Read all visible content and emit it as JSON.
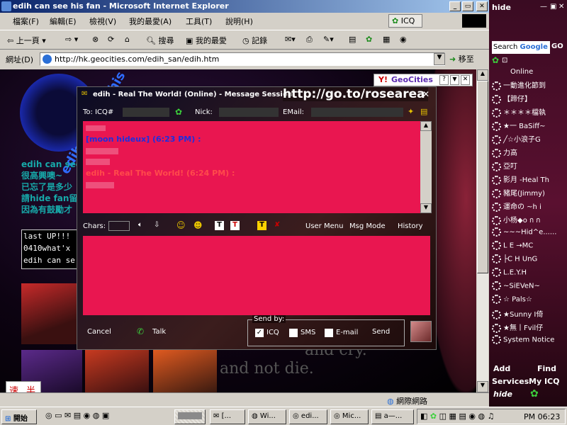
{
  "window": {
    "title": "edih can see his fan - Microsoft Internet Explorer"
  },
  "menu": [
    "檔案(F)",
    "編輯(E)",
    "檢視(V)",
    "我的最愛(A)",
    "工具(T)",
    "說明(H)"
  ],
  "toolbar": {
    "back": "上一頁",
    "search": "搜尋",
    "favorites": "我的最愛",
    "history": "記錄",
    "icq": "ICQ"
  },
  "address": {
    "label": "網址(D)",
    "url": "http://hk.geocities.com/edih_san/edih.htm",
    "go": "移至"
  },
  "page": {
    "arc_text": "edih can see his fan",
    "lines": [
      "edih can see his fan",
      "很高興噢~",
      "已忘了是多少",
      "請hide fan留",
      "因為有鼓勵才"
    ],
    "box_lines": [
      "last UP!!!",
      "0410what'x",
      "edih can se"
    ],
    "geocities": "GeoCities",
    "overlay_bottom": "and cry.",
    "overlay_bottom2": "and not die.",
    "quick_buttons": [
      "速",
      "半"
    ]
  },
  "status": {
    "zone": "網際網路"
  },
  "icq_panel": {
    "search_label": "Search",
    "google": "Google",
    "go": "GO",
    "online": "Online",
    "contacts": [
      "一動進化節到",
      "【蹄仔】",
      "＊＊＊＊檔執",
      "★一 BaSiff~",
      "╱☆小浪子G",
      "力高",
      "亞叮",
      "影月 -Heal Th",
      "豬尾(Jimmy)",
      "運命の ~h i",
      "小杨◆o ก ก",
      "~~~Hid^e......",
      "L E →MC",
      "├C H UnG",
      "L.E.Y.H",
      "~SiEVeN~",
      "☆ Pals☆",
      "★Sunny Ⅰ倚",
      "★無丨Fvil仔",
      "System Notice"
    ],
    "add": "Add",
    "find": "Find",
    "services": "Services",
    "my_icq": "My ICQ",
    "footer": "hide"
  },
  "msg": {
    "title": "edih - Real The World! (Online) - Message Session",
    "overlay_url": "http://go.to/rosearea",
    "to_label": "To: ICQ#",
    "nick_label": "Nick:",
    "email_label": "EMail:",
    "incoming_lines": [
      {
        "text": "[moon hideux]   (6:23 PM) :",
        "color": "#1d2fe0"
      },
      {
        "text": "edih - Real The World!  (6:24 PM) :",
        "color": "#ff2020"
      }
    ],
    "chars_label": "Chars:",
    "user_menu": "User Menu",
    "msg_mode": "Msg Mode",
    "history": "History",
    "send_by": "Send by:",
    "opt_icq": "ICQ",
    "opt_sms": "SMS",
    "opt_email": "E-mail",
    "cancel": "Cancel",
    "talk": "Talk",
    "send": "Send"
  },
  "taskbar": {
    "start": "開始",
    "tasks": [
      "[...",
      "Wi...",
      "edi...",
      "Mic...",
      "a—..."
    ],
    "clock": "PM 06:23"
  }
}
